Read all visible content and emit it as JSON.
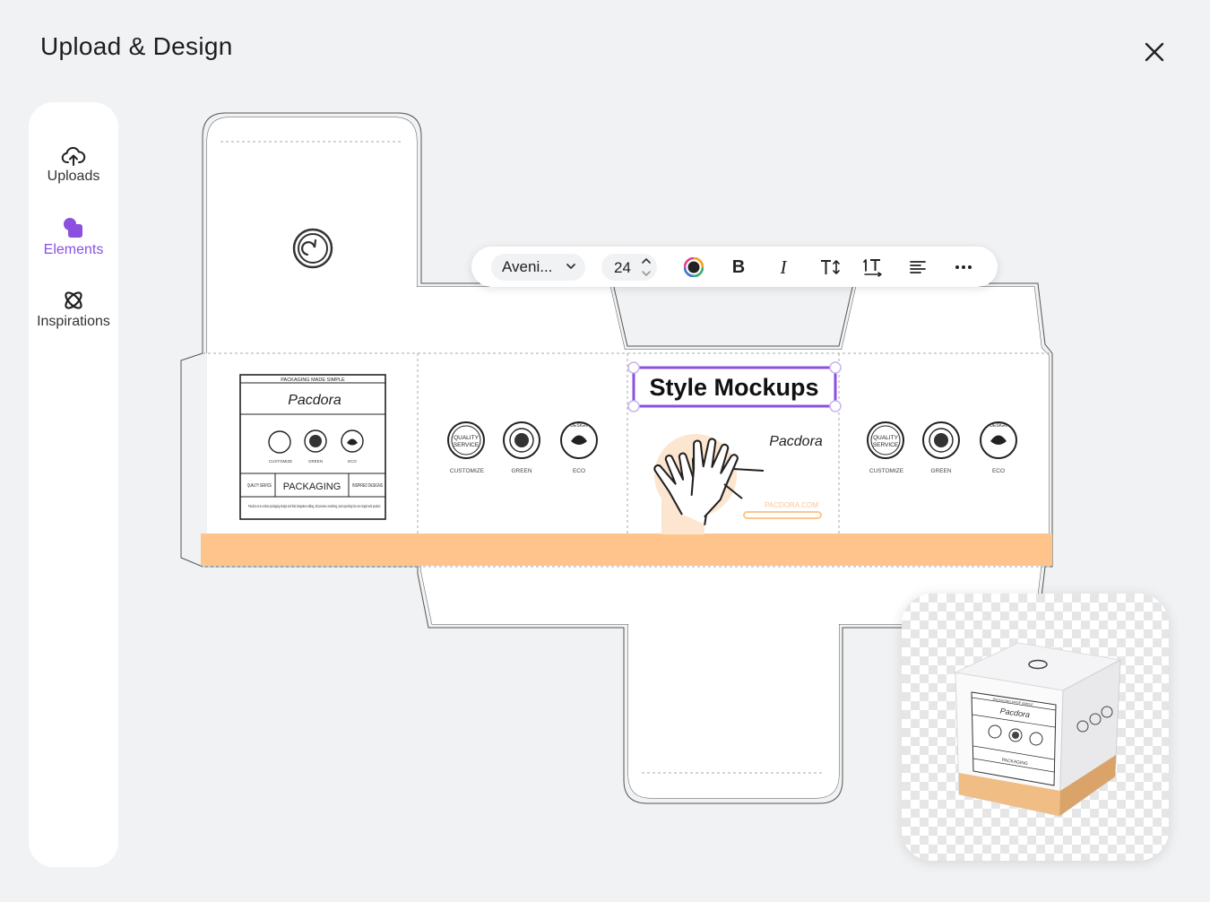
{
  "header": {
    "title": "Upload & Design"
  },
  "sidebar": {
    "items": [
      {
        "label": "Uploads",
        "icon": "cloud-upload-icon",
        "active": false
      },
      {
        "label": "Elements",
        "icon": "shapes-icon",
        "active": true
      },
      {
        "label": "Inspirations",
        "icon": "atom-icon",
        "active": false
      }
    ]
  },
  "toolbar": {
    "font": "Aveni...",
    "font_size": "24",
    "color": "#222222",
    "bold": "B",
    "italic": "I"
  },
  "dieline": {
    "front_panel": {
      "top_line": "PACKAGING MADE SIMPLE",
      "brand": "Pacdora",
      "badge_labels": [
        "CUSTOMIZE",
        "GREEN",
        "ECO"
      ],
      "quality": "QUALITY SERVICE",
      "packaging": "PACKAGING",
      "inspired": "INSPIRED DESIGNS",
      "description": "Pacdora is an online packaging design tool that integrates editing, 3D preview, rendering, and exporting into one single web product."
    },
    "side_badges": {
      "quality_line1": "QUALITY",
      "quality_line2": "SERVICE",
      "design_text": "DESIGN",
      "labels": [
        "CUSTOMIZE",
        "GREEN",
        "ECO"
      ]
    },
    "selected_text": "Style Mockups",
    "brand_panel": {
      "brand": "Pacdora",
      "url": "PACDORA.COM"
    },
    "accent_color": "#ffc48c",
    "selection_color": "#8b50e0"
  },
  "preview": {
    "top_line": "PACKAGING MADE SIMPLE",
    "brand": "Pacdora",
    "packaging": "PACKAGING"
  }
}
